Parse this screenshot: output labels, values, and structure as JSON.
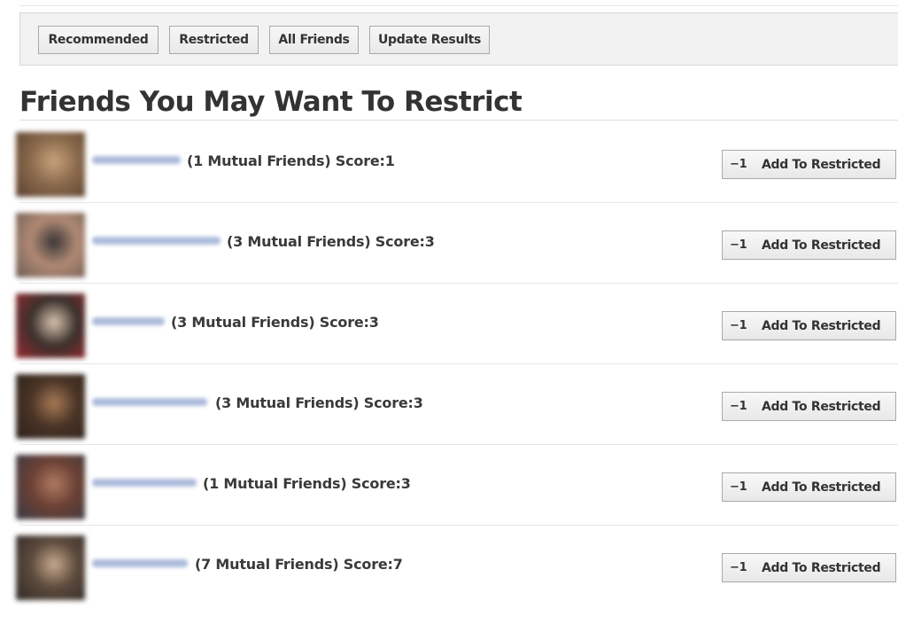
{
  "toolbar": {
    "buttons": [
      {
        "label": "Recommended"
      },
      {
        "label": "Restricted"
      },
      {
        "label": "All Friends"
      },
      {
        "label": "Update Results"
      }
    ]
  },
  "heading": "Friends You May Want To Restrict",
  "add_button_icon": "minus-one-icon",
  "friends": [
    {
      "info": "(1 Mutual Friends) Score:1",
      "button_icon": "−1",
      "button_label": "Add To Restricted",
      "avatar_colors": [
        "#8a6a4c",
        "#c9a27c",
        "#5a4030"
      ]
    },
    {
      "info": "(3 Mutual Friends) Score:3",
      "button_icon": "−1",
      "button_label": "Add To Restricted",
      "avatar_colors": [
        "#b08a74",
        "#3a3638",
        "#6d5a52"
      ]
    },
    {
      "info": "(3 Mutual Friends) Score:3",
      "button_icon": "−1",
      "button_label": "Add To Restricted",
      "avatar_colors": [
        "#3b302c",
        "#d8c4ae",
        "#9a2a30"
      ]
    },
    {
      "info": "(3 Mutual Friends) Score:3",
      "button_icon": "−1",
      "button_label": "Add To Restricted",
      "avatar_colors": [
        "#4a3426",
        "#a77a55",
        "#2c211b"
      ]
    },
    {
      "info": "(1 Mutual Friends) Score:3",
      "button_icon": "−1",
      "button_label": "Add To Restricted",
      "avatar_colors": [
        "#6a4034",
        "#b07a62",
        "#3a3a44"
      ]
    },
    {
      "info": "(7 Mutual Friends) Score:7",
      "button_icon": "−1",
      "button_label": "Add To Restricted",
      "avatar_colors": [
        "#5c4a3c",
        "#c8aa8e",
        "#2f2a28"
      ]
    }
  ]
}
